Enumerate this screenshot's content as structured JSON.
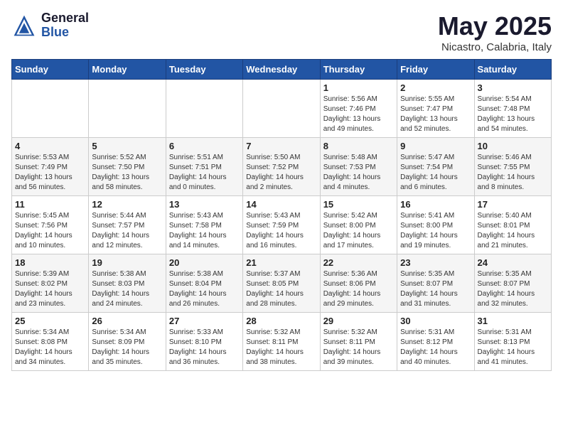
{
  "header": {
    "logo_general": "General",
    "logo_blue": "Blue",
    "title": "May 2025",
    "subtitle": "Nicastro, Calabria, Italy"
  },
  "calendar": {
    "days_of_week": [
      "Sunday",
      "Monday",
      "Tuesday",
      "Wednesday",
      "Thursday",
      "Friday",
      "Saturday"
    ],
    "weeks": [
      [
        {
          "day": "",
          "info": ""
        },
        {
          "day": "",
          "info": ""
        },
        {
          "day": "",
          "info": ""
        },
        {
          "day": "",
          "info": ""
        },
        {
          "day": "1",
          "info": "Sunrise: 5:56 AM\nSunset: 7:46 PM\nDaylight: 13 hours\nand 49 minutes."
        },
        {
          "day": "2",
          "info": "Sunrise: 5:55 AM\nSunset: 7:47 PM\nDaylight: 13 hours\nand 52 minutes."
        },
        {
          "day": "3",
          "info": "Sunrise: 5:54 AM\nSunset: 7:48 PM\nDaylight: 13 hours\nand 54 minutes."
        }
      ],
      [
        {
          "day": "4",
          "info": "Sunrise: 5:53 AM\nSunset: 7:49 PM\nDaylight: 13 hours\nand 56 minutes."
        },
        {
          "day": "5",
          "info": "Sunrise: 5:52 AM\nSunset: 7:50 PM\nDaylight: 13 hours\nand 58 minutes."
        },
        {
          "day": "6",
          "info": "Sunrise: 5:51 AM\nSunset: 7:51 PM\nDaylight: 14 hours\nand 0 minutes."
        },
        {
          "day": "7",
          "info": "Sunrise: 5:50 AM\nSunset: 7:52 PM\nDaylight: 14 hours\nand 2 minutes."
        },
        {
          "day": "8",
          "info": "Sunrise: 5:48 AM\nSunset: 7:53 PM\nDaylight: 14 hours\nand 4 minutes."
        },
        {
          "day": "9",
          "info": "Sunrise: 5:47 AM\nSunset: 7:54 PM\nDaylight: 14 hours\nand 6 minutes."
        },
        {
          "day": "10",
          "info": "Sunrise: 5:46 AM\nSunset: 7:55 PM\nDaylight: 14 hours\nand 8 minutes."
        }
      ],
      [
        {
          "day": "11",
          "info": "Sunrise: 5:45 AM\nSunset: 7:56 PM\nDaylight: 14 hours\nand 10 minutes."
        },
        {
          "day": "12",
          "info": "Sunrise: 5:44 AM\nSunset: 7:57 PM\nDaylight: 14 hours\nand 12 minutes."
        },
        {
          "day": "13",
          "info": "Sunrise: 5:43 AM\nSunset: 7:58 PM\nDaylight: 14 hours\nand 14 minutes."
        },
        {
          "day": "14",
          "info": "Sunrise: 5:43 AM\nSunset: 7:59 PM\nDaylight: 14 hours\nand 16 minutes."
        },
        {
          "day": "15",
          "info": "Sunrise: 5:42 AM\nSunset: 8:00 PM\nDaylight: 14 hours\nand 17 minutes."
        },
        {
          "day": "16",
          "info": "Sunrise: 5:41 AM\nSunset: 8:00 PM\nDaylight: 14 hours\nand 19 minutes."
        },
        {
          "day": "17",
          "info": "Sunrise: 5:40 AM\nSunset: 8:01 PM\nDaylight: 14 hours\nand 21 minutes."
        }
      ],
      [
        {
          "day": "18",
          "info": "Sunrise: 5:39 AM\nSunset: 8:02 PM\nDaylight: 14 hours\nand 23 minutes."
        },
        {
          "day": "19",
          "info": "Sunrise: 5:38 AM\nSunset: 8:03 PM\nDaylight: 14 hours\nand 24 minutes."
        },
        {
          "day": "20",
          "info": "Sunrise: 5:38 AM\nSunset: 8:04 PM\nDaylight: 14 hours\nand 26 minutes."
        },
        {
          "day": "21",
          "info": "Sunrise: 5:37 AM\nSunset: 8:05 PM\nDaylight: 14 hours\nand 28 minutes."
        },
        {
          "day": "22",
          "info": "Sunrise: 5:36 AM\nSunset: 8:06 PM\nDaylight: 14 hours\nand 29 minutes."
        },
        {
          "day": "23",
          "info": "Sunrise: 5:35 AM\nSunset: 8:07 PM\nDaylight: 14 hours\nand 31 minutes."
        },
        {
          "day": "24",
          "info": "Sunrise: 5:35 AM\nSunset: 8:07 PM\nDaylight: 14 hours\nand 32 minutes."
        }
      ],
      [
        {
          "day": "25",
          "info": "Sunrise: 5:34 AM\nSunset: 8:08 PM\nDaylight: 14 hours\nand 34 minutes."
        },
        {
          "day": "26",
          "info": "Sunrise: 5:34 AM\nSunset: 8:09 PM\nDaylight: 14 hours\nand 35 minutes."
        },
        {
          "day": "27",
          "info": "Sunrise: 5:33 AM\nSunset: 8:10 PM\nDaylight: 14 hours\nand 36 minutes."
        },
        {
          "day": "28",
          "info": "Sunrise: 5:32 AM\nSunset: 8:11 PM\nDaylight: 14 hours\nand 38 minutes."
        },
        {
          "day": "29",
          "info": "Sunrise: 5:32 AM\nSunset: 8:11 PM\nDaylight: 14 hours\nand 39 minutes."
        },
        {
          "day": "30",
          "info": "Sunrise: 5:31 AM\nSunset: 8:12 PM\nDaylight: 14 hours\nand 40 minutes."
        },
        {
          "day": "31",
          "info": "Sunrise: 5:31 AM\nSunset: 8:13 PM\nDaylight: 14 hours\nand 41 minutes."
        }
      ]
    ]
  }
}
